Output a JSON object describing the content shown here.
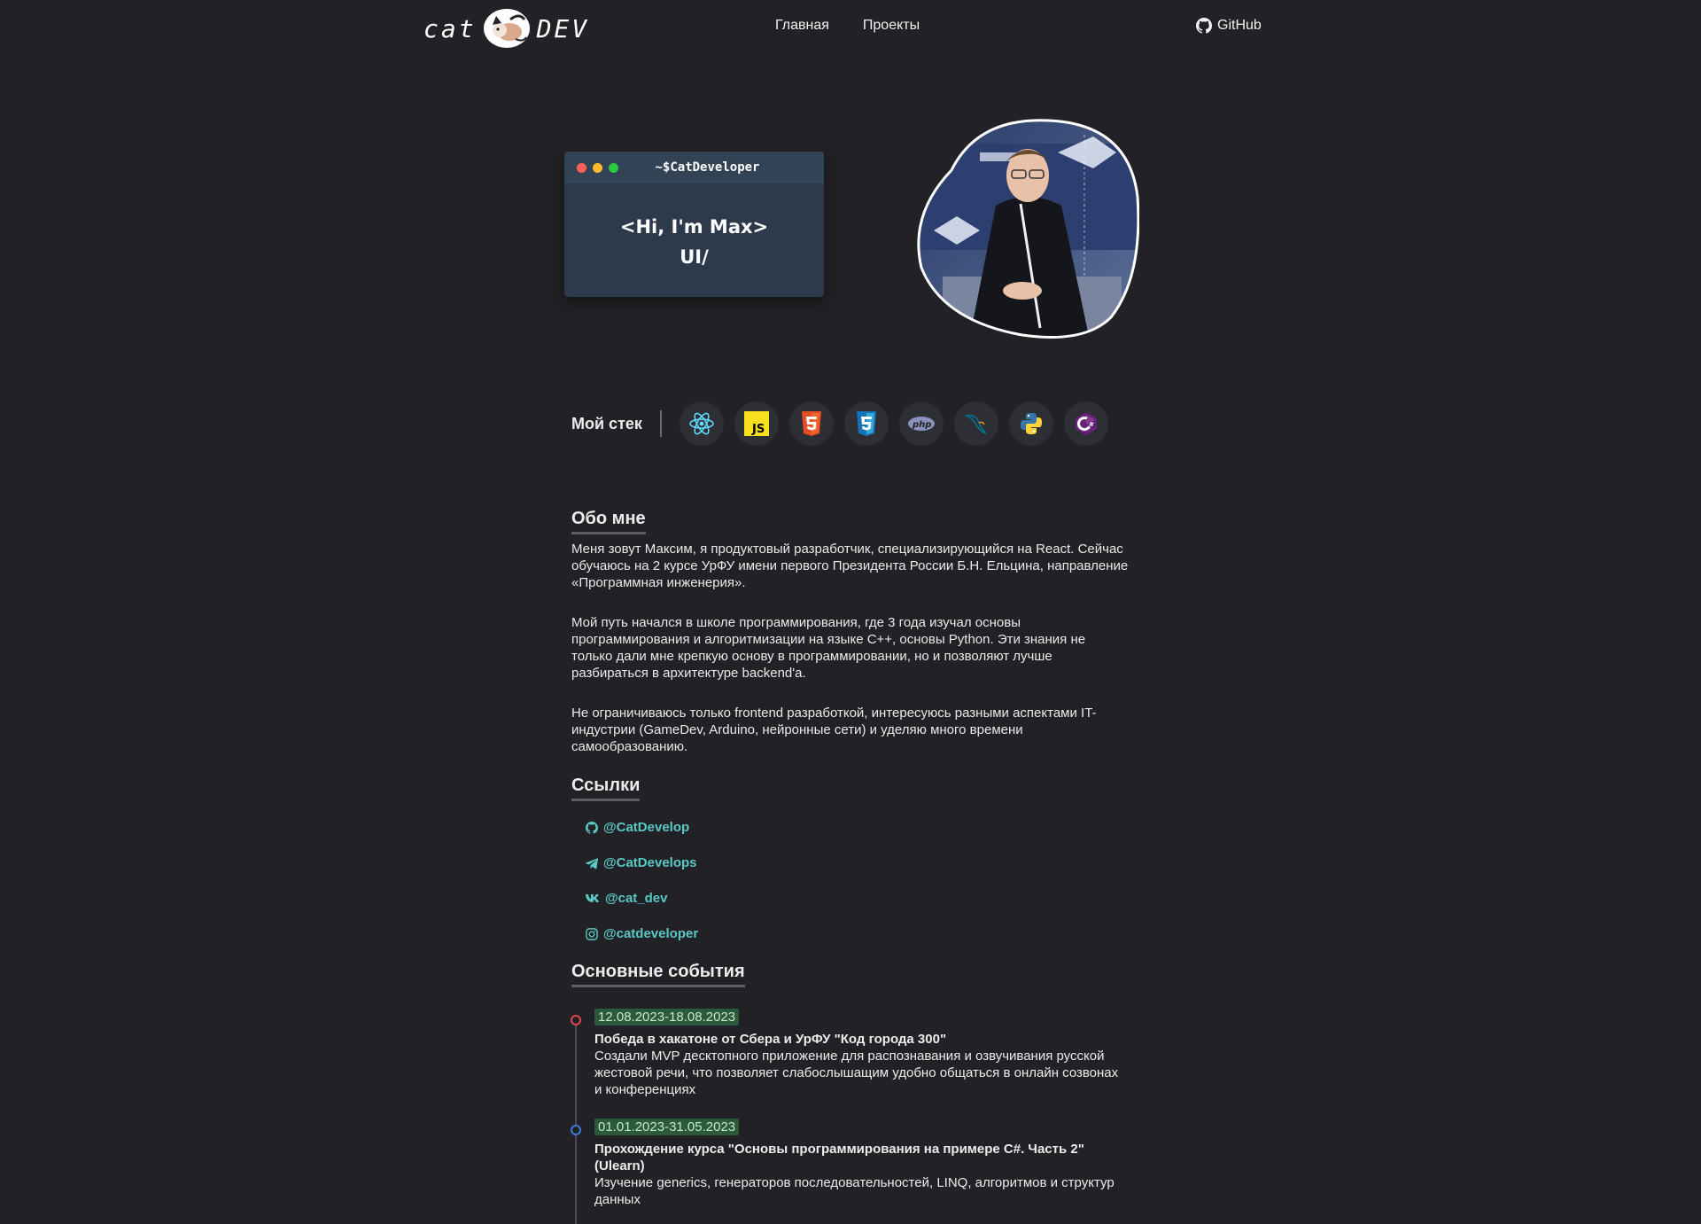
{
  "header": {
    "logo_left": "cat",
    "logo_right": "DEV",
    "nav": [
      {
        "label": "Главная"
      },
      {
        "label": "Проекты"
      }
    ],
    "github_label": "GitHub"
  },
  "terminal": {
    "title": "~$CatDeveloper",
    "line1": "<Hi, I'm Max>",
    "line2": "UI/",
    "dot_colors": [
      "#ff5f57",
      "#febc2e",
      "#28c840"
    ]
  },
  "stack": {
    "label": "Мой стек",
    "items": [
      "react-icon",
      "javascript-icon",
      "html5-icon",
      "css3-icon",
      "php-icon",
      "mysql-icon",
      "python-icon",
      "csharp-icon"
    ]
  },
  "about": {
    "heading": "Обо мне",
    "paragraphs": [
      "Меня зовут Максим, я продуктовый разработчик, специализирующийся на React. Сейчас обучаюсь на 2 курсе УрФУ имени первого Президента России Б.Н. Ельцина, направление «Программная инженерия».",
      "Мой путь начался в школе программирования, где 3 года изучал основы программирования и алгоритмизации на языке C++, основы Python. Эти знания не только дали мне крепкую основу в программировании, но и позволяют лучше разбираться в архитектуре backend'a.",
      "Не ограничиваюсь только frontend разработкой, интересуюсь разными аспектами IT-индустрии (GameDev, Arduino, нейронные сети) и уделяю много времени самообразованию."
    ]
  },
  "links": {
    "heading": "Ссылки",
    "items": [
      {
        "icon": "github-icon",
        "label": "@CatDevelop"
      },
      {
        "icon": "telegram-icon",
        "label": "@CatDevelops"
      },
      {
        "icon": "vk-icon",
        "label": "@cat_dev"
      },
      {
        "icon": "instagram-icon",
        "label": "@catdeveloper"
      }
    ]
  },
  "events": {
    "heading": "Основные события",
    "items": [
      {
        "date": "12.08.2023-18.08.2023",
        "title": "Победа в хакатоне от Сбера и УрФУ \"Код города 300\"",
        "description": "Создали MVP десктопного приложение для распознавания и озвучивания русской жестовой речи, что позволяет слабослышащим удобно общаться в онлайн созвонах и конференциях",
        "marker_color": "#e0474c"
      },
      {
        "date": "01.01.2023-31.05.2023",
        "title": "Прохождение курса \"Основы программирования на примере C#. Часть 2\" (Ulearn)",
        "description": "Изучение generics, генераторов последовательностей, LINQ, алгоритмов и структур данных",
        "marker_color": "#3d7bd9"
      }
    ]
  },
  "colors": {
    "background": "#222226",
    "accent": "#58c9c4",
    "date_bg": "#2a5a3a"
  }
}
